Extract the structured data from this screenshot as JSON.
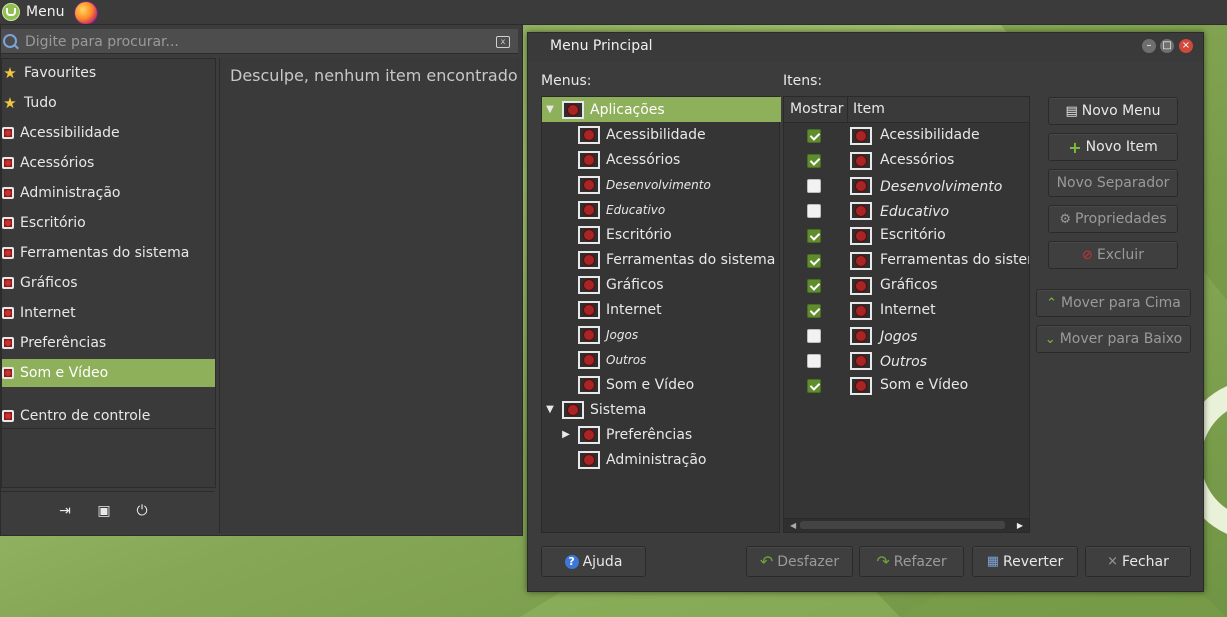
{
  "panel": {
    "menu_label": "Menu"
  },
  "startmenu": {
    "search_placeholder": "Digite para procurar...",
    "categories": [
      {
        "label": "Favourites",
        "icon": "star-icon"
      },
      {
        "label": "Tudo",
        "icon": "star-icon"
      },
      {
        "label": "Acessibilidade",
        "icon": "app-icon"
      },
      {
        "label": "Acessórios",
        "icon": "app-icon"
      },
      {
        "label": "Administração",
        "icon": "app-icon"
      },
      {
        "label": "Escritório",
        "icon": "app-icon"
      },
      {
        "label": "Ferramentas do sistema",
        "icon": "app-icon"
      },
      {
        "label": "Gráficos",
        "icon": "app-icon"
      },
      {
        "label": "Internet",
        "icon": "app-icon"
      },
      {
        "label": "Preferências",
        "icon": "app-icon"
      },
      {
        "label": "Som e Vídeo",
        "icon": "app-icon",
        "selected": true
      },
      {
        "label": "Centro de controle",
        "icon": "app-icon"
      }
    ],
    "no_results": "Desculpe, nenhum item encontrado"
  },
  "dialog": {
    "title": "Menu Principal",
    "menus_label": "Menus:",
    "items_label": "Itens:",
    "tree": [
      {
        "label": "Aplicações",
        "level": 0,
        "expander": "down",
        "selected": true,
        "italic": false
      },
      {
        "label": "Acessibilidade",
        "level": 1,
        "italic": false
      },
      {
        "label": "Acessórios",
        "level": 1,
        "italic": false
      },
      {
        "label": "Desenvolvimento",
        "level": 1,
        "italic": true
      },
      {
        "label": "Educativo",
        "level": 1,
        "italic": true
      },
      {
        "label": "Escritório",
        "level": 1,
        "italic": false
      },
      {
        "label": "Ferramentas do sistema",
        "level": 1,
        "italic": false
      },
      {
        "label": "Gráficos",
        "level": 1,
        "italic": false
      },
      {
        "label": "Internet",
        "level": 1,
        "italic": false
      },
      {
        "label": "Jogos",
        "level": 1,
        "italic": true
      },
      {
        "label": "Outros",
        "level": 1,
        "italic": true
      },
      {
        "label": "Som e Vídeo",
        "level": 1,
        "italic": false
      },
      {
        "label": "Sistema",
        "level": 0,
        "expander": "down",
        "italic": false
      },
      {
        "label": "Preferências",
        "level": 1,
        "expander": "right",
        "italic": false
      },
      {
        "label": "Administração",
        "level": 1,
        "italic": false
      }
    ],
    "columns": {
      "show": "Mostrar",
      "item": "Item"
    },
    "items": [
      {
        "label": "Acessibilidade",
        "show": true,
        "italic": false
      },
      {
        "label": "Acessórios",
        "show": true,
        "italic": false
      },
      {
        "label": "Desenvolvimento",
        "show": false,
        "italic": true
      },
      {
        "label": "Educativo",
        "show": false,
        "italic": true
      },
      {
        "label": "Escritório",
        "show": true,
        "italic": false
      },
      {
        "label": "Ferramentas do sistema",
        "show": true,
        "italic": false
      },
      {
        "label": "Gráficos",
        "show": true,
        "italic": false
      },
      {
        "label": "Internet",
        "show": true,
        "italic": false
      },
      {
        "label": "Jogos",
        "show": false,
        "italic": true
      },
      {
        "label": "Outros",
        "show": false,
        "italic": true
      },
      {
        "label": "Som e Vídeo",
        "show": true,
        "italic": false
      }
    ],
    "buttons": {
      "new_menu": "Novo Menu",
      "new_item": "Novo Item",
      "new_separator": "Novo Separador",
      "properties": "Propriedades",
      "delete": "Excluir",
      "move_up": "Mover para Cima",
      "move_down": "Mover para Baixo",
      "help": "Ajuda",
      "undo": "Desfazer",
      "redo": "Refazer",
      "revert": "Reverter",
      "close": "Fechar"
    }
  }
}
